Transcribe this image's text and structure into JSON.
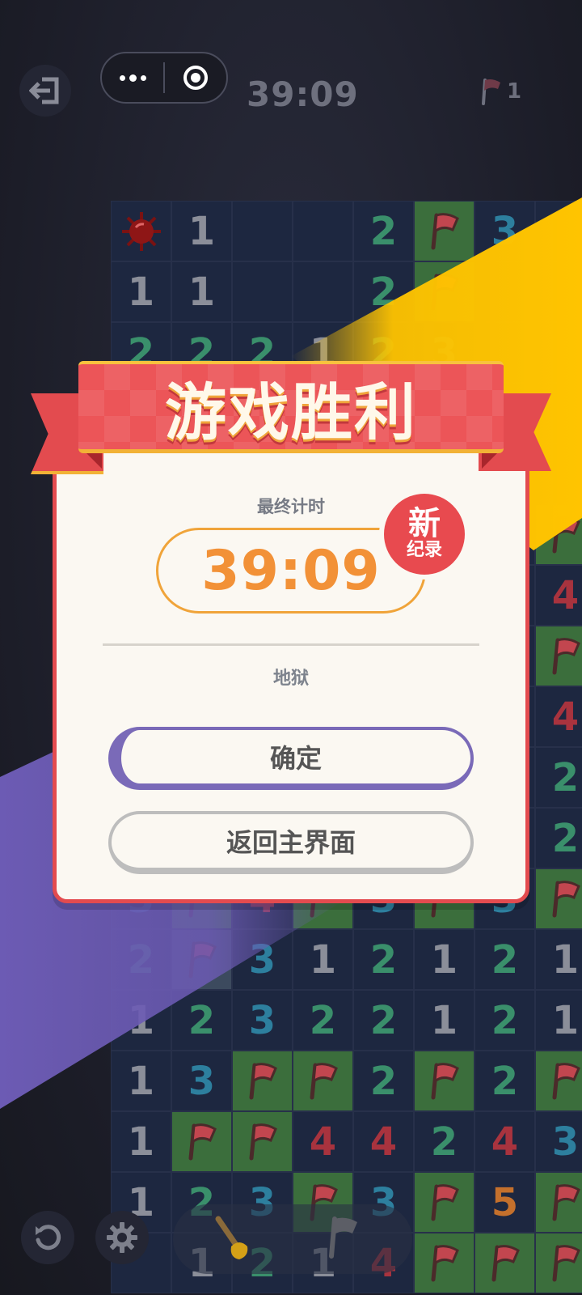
{
  "top_bar": {
    "timer": "39:09",
    "flags_remaining": "1"
  },
  "board": {
    "rows": [
      [
        "mine",
        "1",
        "",
        "",
        "2",
        "F",
        "3",
        ""
      ],
      [
        "1",
        "1",
        "",
        "",
        "2",
        "F",
        "",
        ""
      ],
      [
        "2",
        "2",
        "2",
        "1",
        "2",
        "3",
        "",
        ""
      ],
      [
        "",
        "",
        "",
        "",
        "",
        "",
        "",
        ""
      ],
      [
        "",
        "",
        "",
        "",
        "",
        "",
        "",
        ""
      ],
      [
        "",
        "",
        "",
        "",
        "",
        "",
        "",
        "F"
      ],
      [
        "",
        "",
        "",
        "",
        "",
        "",
        "",
        "4"
      ],
      [
        "",
        "",
        "",
        "",
        "",
        "",
        "",
        "F"
      ],
      [
        "",
        "",
        "",
        "",
        "",
        "",
        "",
        "4"
      ],
      [
        "",
        "",
        "",
        "",
        "",
        "",
        "",
        "2"
      ],
      [
        "",
        "",
        "",
        "",
        "",
        "",
        "",
        "2"
      ],
      [
        "3",
        "F",
        "4",
        "F",
        "3",
        "F",
        "3",
        "F"
      ],
      [
        "2",
        "F",
        "3",
        "1",
        "2",
        "1",
        "2",
        "1"
      ],
      [
        "1",
        "2",
        "3",
        "2",
        "2",
        "1",
        "2",
        "1"
      ],
      [
        "1",
        "3",
        "F",
        "F",
        "2",
        "F",
        "2",
        "F"
      ],
      [
        "1",
        "F",
        "F",
        "4",
        "4",
        "2",
        "4",
        "3"
      ],
      [
        "1",
        "2",
        "3",
        "F",
        "3",
        "F",
        "5",
        "F"
      ],
      [
        "",
        "1",
        "2",
        "1",
        "4",
        "F",
        "F",
        "F"
      ]
    ]
  },
  "dialog": {
    "title": "游戏胜利",
    "final_time_label": "最终计时",
    "final_time": "39:09",
    "badge_line1": "新",
    "badge_line2": "纪录",
    "difficulty": "地狱",
    "confirm_label": "确定",
    "home_label": "返回主界面"
  },
  "colors": {
    "ribbon": "#ec5558",
    "timer_orange": "#f29137",
    "confirm_border": "#7a6ab8",
    "ray_yellow": "#ffc400",
    "ray_purple": "#6c5bb4"
  }
}
